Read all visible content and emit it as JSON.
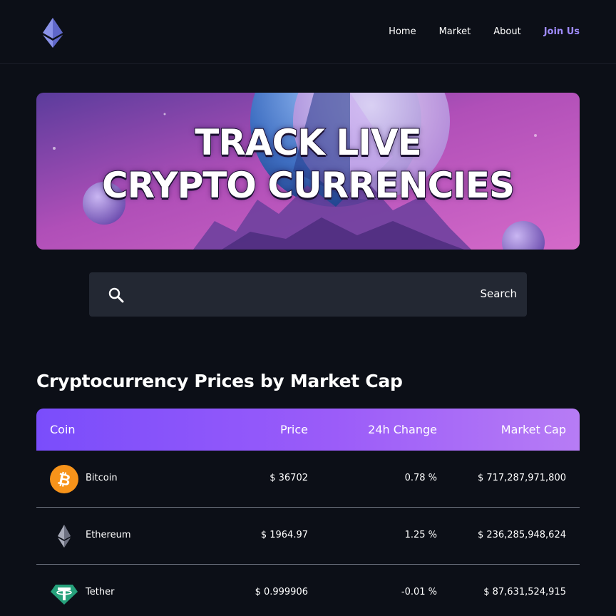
{
  "header": {
    "logo_icon": "ethereum-logo-icon",
    "nav": [
      {
        "label": "Home"
      },
      {
        "label": "Market"
      },
      {
        "label": "About"
      },
      {
        "label": "Join Us"
      }
    ]
  },
  "hero": {
    "line1": "TRACK LIVE",
    "line2": "CRYPTO CURRENCIES"
  },
  "search": {
    "icon": "search-icon",
    "placeholder": "",
    "button_label": "Search"
  },
  "section_title": "Cryptocurrency Prices by Market Cap",
  "table": {
    "headers": {
      "coin": "Coin",
      "price": "Price",
      "change": "24h Change",
      "cap": "Market Cap"
    },
    "rows": [
      {
        "name": "Bitcoin",
        "icon": "bitcoin-icon",
        "price": "$ 36702",
        "change": "0.78 %",
        "cap": "$ 717,287,971,800"
      },
      {
        "name": "Ethereum",
        "icon": "ethereum-icon",
        "price": "$ 1964.97",
        "change": "1.25 %",
        "cap": "$ 236,285,948,624"
      },
      {
        "name": "Tether",
        "icon": "tether-icon",
        "price": "$ 0.999906",
        "change": "-0.01 %",
        "cap": "$ 87,631,524,915"
      }
    ]
  },
  "colors": {
    "background": "#0c0f17",
    "accent": "#a08cff",
    "table_header_start": "#7a4dfb",
    "table_header_end": "#b77cf5",
    "search_bg": "#232833"
  }
}
